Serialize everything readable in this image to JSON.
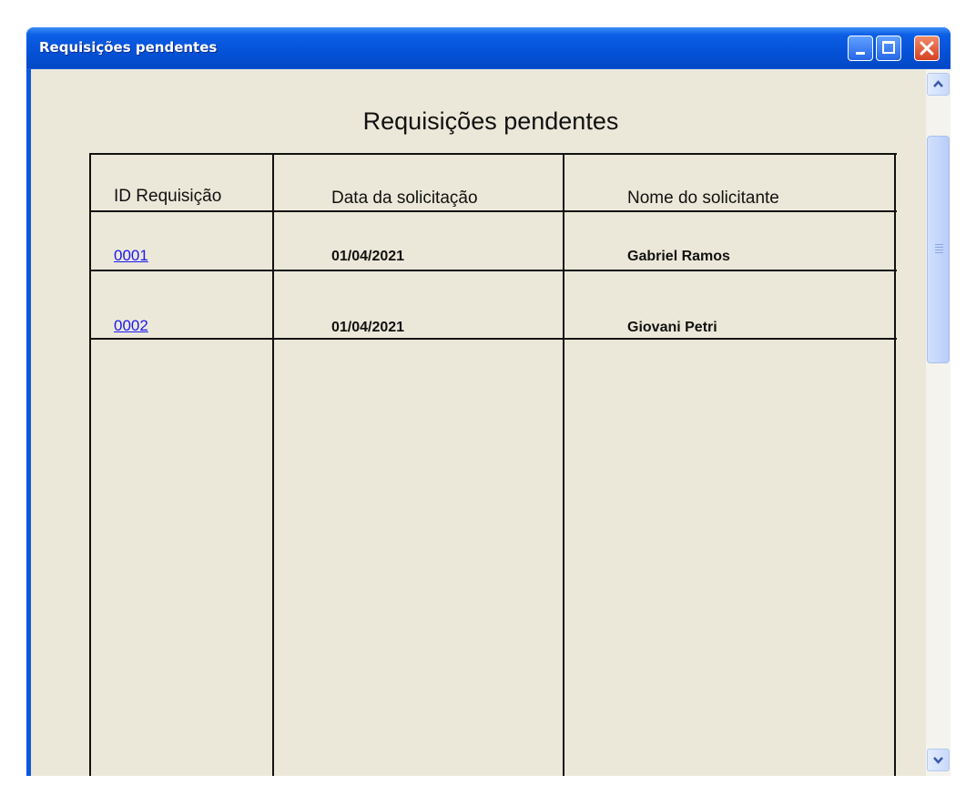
{
  "window": {
    "title": "Requisições pendentes"
  },
  "page": {
    "heading": "Requisições pendentes"
  },
  "table": {
    "columns": [
      "ID Requisição",
      "Data da solicitação",
      "Nome do solicitante"
    ],
    "rows": [
      {
        "id": "0001",
        "date": "01/04/2021",
        "name": "Gabriel Ramos"
      },
      {
        "id": "0002",
        "date": "01/04/2021",
        "name": "Giovani Petri"
      }
    ]
  },
  "icons": {
    "minimize": "minimize-icon",
    "maximize": "maximize-icon",
    "close": "close-icon",
    "scroll_up": "chevron-up-icon",
    "scroll_down": "chevron-down-icon"
  },
  "colors": {
    "titlebar": "#0452d8",
    "client_background": "#ece8d9",
    "link": "#1a1aee",
    "close_button": "#d4411f"
  }
}
